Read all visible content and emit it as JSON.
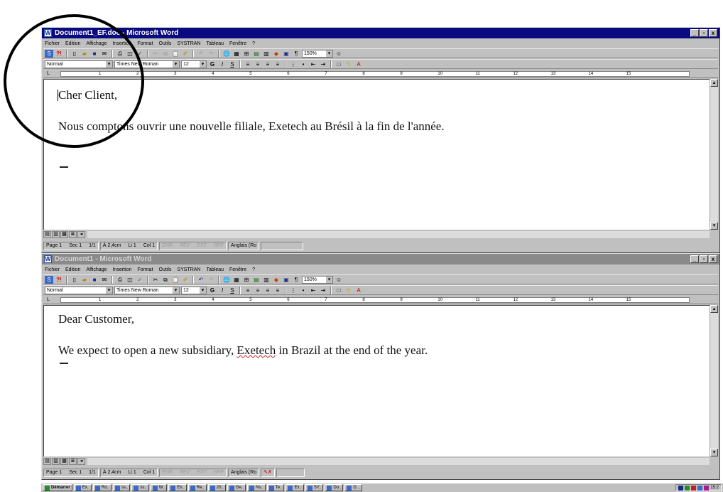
{
  "windows": [
    {
      "id": "fr",
      "title": "Document1_EF.doc - Microsoft Word",
      "active": true,
      "menu": [
        "Fichier",
        "Edition",
        "Affichage",
        "Insertion",
        "Format",
        "Outils",
        "SYSTRAN",
        "Tableau",
        "Fenêtre",
        "?"
      ],
      "style_value": "Normal",
      "font_value": "Times New Roman",
      "size_value": "12",
      "zoom_value": "150%",
      "doc_lines": [
        "Cher Client,",
        "Nous comptons ouvrir une nouvelle filiale, Exetech au Brésil à la fin de l'année."
      ],
      "status": {
        "page": "Page 1",
        "sec": "Sec 1",
        "pages": "1/1",
        "at": "À 2,4cm",
        "line": "Li 1",
        "col": "Col 1",
        "rec": "ENR",
        "rev": "REV",
        "ext": "EXT",
        "ovr": "RFP",
        "lang": "Anglais (Ro"
      }
    },
    {
      "id": "en",
      "title": "Document1 - Microsoft Word",
      "active": false,
      "menu": [
        "Fichier",
        "Edition",
        "Affichage",
        "Insertion",
        "Format",
        "Outils",
        "SYSTRAN",
        "Tableau",
        "Fenêtre",
        "?"
      ],
      "style_value": "Normal",
      "font_value": "Times New Roman",
      "size_value": "12",
      "zoom_value": "150%",
      "doc_lines": [
        "Dear Customer,",
        "We expect  to open a new subsidiary, ",
        "Exetech",
        " in Brazil at the end of the year."
      ],
      "status": {
        "page": "Page 1",
        "sec": "Sec 1",
        "pages": "1/1",
        "at": "À 2,4cm",
        "line": "Li 1",
        "col": "Col 1",
        "rec": "ENR",
        "rev": "REV",
        "ext": "EXT",
        "ovr": "RFP",
        "lang": "Anglais (Ro"
      }
    }
  ],
  "taskbar": {
    "start_label": "Démarrer",
    "items": [
      "Ex..",
      "Ro..",
      "ss..",
      "ss..",
      "W..",
      "Ex..",
      "Re..",
      "20..",
      "Ge..",
      "Ns..",
      "Te..",
      "Ex..",
      "SY..",
      "Do..",
      "D..."
    ],
    "clock": "15:2"
  },
  "ruler_numbers": [
    "1",
    "2",
    "3",
    "4",
    "5",
    "6",
    "7",
    "8",
    "9",
    "10",
    "11",
    "12",
    "13",
    "14",
    "15"
  ],
  "colors": {
    "active_title": "#0a0a80",
    "inactive_title": "#8a8a8a",
    "chrome": "#c0c0c0",
    "annotation_circle": "#000000"
  }
}
